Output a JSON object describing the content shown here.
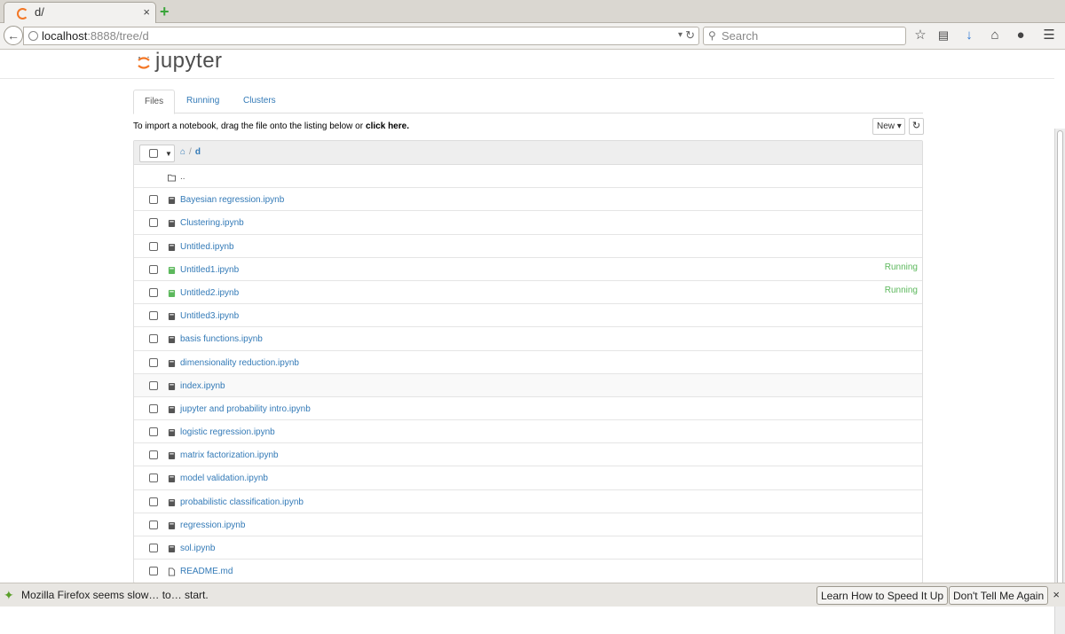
{
  "browser": {
    "tab_title": "d/",
    "tab_close": "×",
    "new_tab": "+",
    "url_host": "localhost",
    "url_rest": ":8888/tree/d",
    "search_placeholder": "Search",
    "toolbar_icons": [
      "bookmark-star-icon",
      "reading-list-icon",
      "download-icon",
      "home-icon",
      "chat-icon",
      "menu-icon"
    ]
  },
  "jupyter": {
    "logo_text": "jupyter",
    "tabs": [
      {
        "label": "Files",
        "active": true
      },
      {
        "label": "Running",
        "active": false
      },
      {
        "label": "Clusters",
        "active": false
      }
    ],
    "import_text": "To import a notebook, drag the file onto the listing below or",
    "import_link": "click here.",
    "new_label": "New",
    "breadcrumb": {
      "sep": "/",
      "folder": "d"
    },
    "parent_dir": "..",
    "files": [
      {
        "name": "Bayesian regression.ipynb",
        "type": "notebook",
        "status": ""
      },
      {
        "name": "Clustering.ipynb",
        "type": "notebook",
        "status": ""
      },
      {
        "name": "Untitled.ipynb",
        "type": "notebook",
        "status": ""
      },
      {
        "name": "Untitled1.ipynb",
        "type": "notebook-running",
        "status": "Running"
      },
      {
        "name": "Untitled2.ipynb",
        "type": "notebook-running",
        "status": "Running"
      },
      {
        "name": "Untitled3.ipynb",
        "type": "notebook",
        "status": ""
      },
      {
        "name": "basis functions.ipynb",
        "type": "notebook",
        "status": ""
      },
      {
        "name": "dimensionality reduction.ipynb",
        "type": "notebook",
        "status": ""
      },
      {
        "name": "index.ipynb",
        "type": "notebook",
        "status": ""
      },
      {
        "name": "jupyter and probability intro.ipynb",
        "type": "notebook",
        "status": ""
      },
      {
        "name": "logistic regression.ipynb",
        "type": "notebook",
        "status": ""
      },
      {
        "name": "matrix factorization.ipynb",
        "type": "notebook",
        "status": ""
      },
      {
        "name": "model validation.ipynb",
        "type": "notebook",
        "status": ""
      },
      {
        "name": "probabilistic classification.ipynb",
        "type": "notebook",
        "status": ""
      },
      {
        "name": "regression.ipynb",
        "type": "notebook",
        "status": ""
      },
      {
        "name": "sol.ipynb",
        "type": "notebook",
        "status": ""
      },
      {
        "name": "README.md",
        "type": "file",
        "status": ""
      }
    ]
  },
  "notification": {
    "text": "Mozilla Firefox seems slow… to… start.",
    "learn_button": "Learn How to Speed It Up",
    "dismiss_button": "Don't Tell Me Again",
    "close": "×"
  },
  "colors": {
    "link": "#337ab7",
    "running": "#5cb85c",
    "jupyter_orange": "#f37726"
  }
}
